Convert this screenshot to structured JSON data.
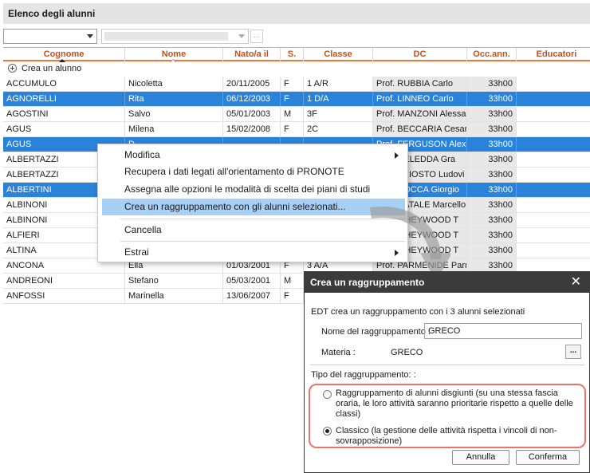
{
  "window": {
    "title": "Elenco degli alunni"
  },
  "filters": {
    "dots": "..."
  },
  "table": {
    "headers": [
      "Cognome",
      "Nome",
      "Nato/a il",
      "S.",
      "Classe",
      "DC",
      "Occ.ann.",
      "Educatori"
    ],
    "new_row_label": "Crea un alunno",
    "rows": [
      [
        "ACCUMULO",
        "Nicoletta",
        "20/11/2005",
        "F",
        "1 A/R",
        "Prof. RUBBIA Carlo",
        "33h00"
      ],
      [
        "AGNORELLI",
        "Rita",
        "06/12/2003",
        "F",
        "1 D/A",
        "Prof. LINNEO Carlo",
        "33h00"
      ],
      [
        "AGOSTINI",
        "Salvo",
        "05/01/2003",
        "M",
        "3F",
        "Prof. MANZONI Alessa",
        "33h00"
      ],
      [
        "AGUS",
        "Milena",
        "15/02/2008",
        "F",
        "2C",
        "Prof. BECCARIA Cesar",
        "33h00"
      ],
      [
        "AGUS",
        "D",
        "",
        "",
        "",
        "Prof. FERGUSON Alex",
        "33h00"
      ],
      [
        "ALBERTAZZI",
        "",
        "",
        "",
        "",
        "Prof. DELEDDA Gra",
        "33h00"
      ],
      [
        "ALBERTAZZI",
        "",
        "",
        "",
        "",
        "Prof. ARIOSTO Ludovi",
        "33h00"
      ],
      [
        "ALBERTINI",
        "",
        "",
        "",
        "",
        "Prof. ROCCA Giorgio",
        "33h00"
      ],
      [
        "ALBINONI",
        "",
        "",
        "",
        "",
        "Prof. NATALE Marcello",
        "33h00"
      ],
      [
        "ALBINONI",
        "",
        "",
        "",
        "",
        "Prof. a HEYWOOD T",
        "33h00"
      ],
      [
        "ALFIERI",
        "",
        "",
        "",
        "",
        "Prof. a HEYWOOD T",
        "33h00"
      ],
      [
        "ALTINA",
        "",
        "",
        "",
        "",
        "Prof. a HEYWOOD T",
        "33h00"
      ],
      [
        "ANCONA",
        "Ella",
        "01/03/2001",
        "F",
        "3 A/A",
        "Prof. PARMENIDE Parm",
        "33h00"
      ],
      [
        "ANDREONI",
        "Stefano",
        "05/03/2001",
        "M",
        "",
        "",
        ""
      ],
      [
        "ANFOSSI",
        "Marinella",
        "13/06/2007",
        "F",
        "",
        "",
        ""
      ]
    ],
    "selected_rows": [
      1,
      4,
      7
    ]
  },
  "context_menu": {
    "items": [
      "Modifica",
      "Recupera i dati legati all'orientamento di PRONOTE",
      "Assegna alle opzioni le modalità di scelta dei piani di studi",
      "Crea un raggruppamento con gli alunni selezionati...",
      "Cancella",
      "Estrai"
    ]
  },
  "dialog": {
    "title": "Crea un raggruppamento",
    "close": "✕",
    "intro": "EDT crea un raggruppamento con i 3 alunni selezionati",
    "name_label": "Nome del raggruppamento :",
    "name_value": "GRECO",
    "subject_label": "Materia :",
    "subject_value": "GRECO",
    "ellipsis": "...",
    "type_label": "Tipo del raggruppamento: :",
    "option1": "Raggruppamento di alunni disgiunti (su una stessa fascia oraria, le loro attività saranno prioritarie rispetto a quelle delle classi)",
    "option2": "Classico (la gestione delle attività rispetta i vincoli di non-sovrapposizione)",
    "selected_option": 2,
    "cancel": "Annulla",
    "confirm": "Conferma"
  },
  "colors": {
    "header_text": "#c2521f",
    "selection": "#2b82d9",
    "menu_highlight": "#a8d0f4",
    "dialog_title_bg": "#3b3b3b",
    "highlight_border": "#f0736a"
  }
}
